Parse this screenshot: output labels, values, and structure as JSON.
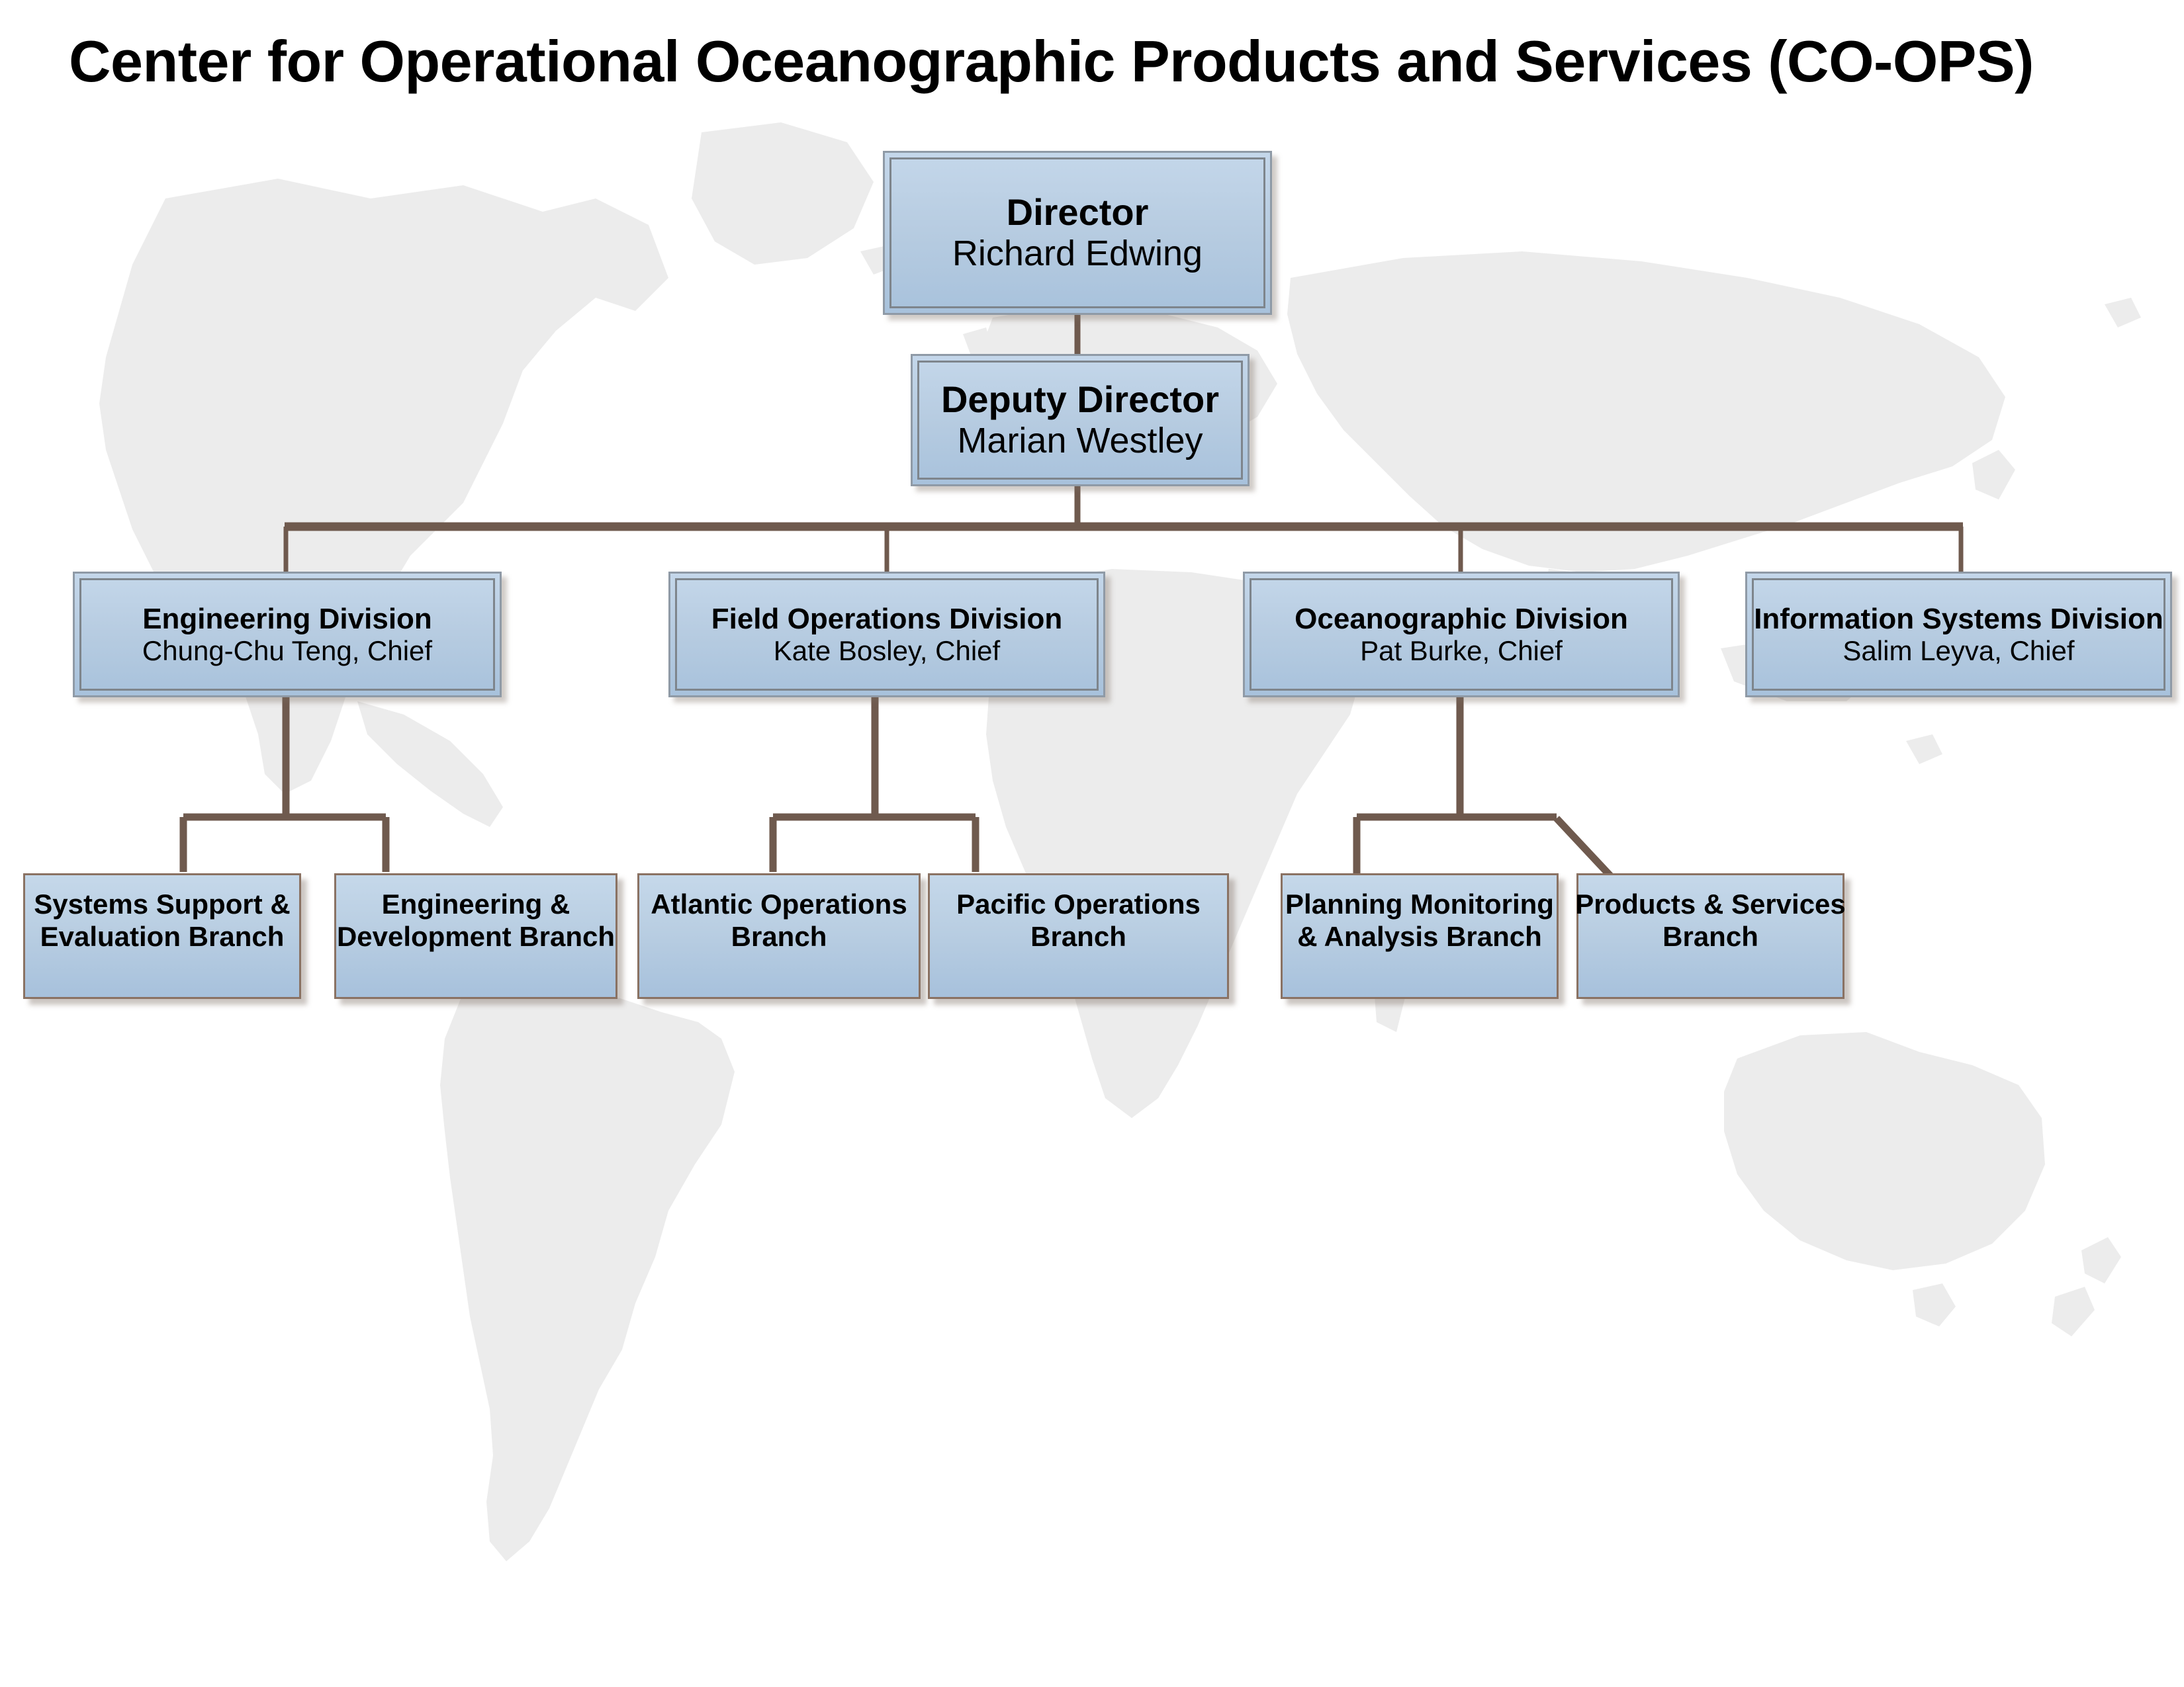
{
  "page": {
    "title": "Center for Operational Oceanographic Products and Services (CO-OPS)",
    "background_map": "world-map-watermark"
  },
  "colors": {
    "box_fill_top": "#c4d7ea",
    "box_fill_bottom": "#a8c2dc",
    "box_border_outer": "#8f9aa6",
    "box_border_inner": "#7e858c",
    "branch_border": "#8a7263",
    "connector_line": "#6f5a4e",
    "map_fill": "#ececec",
    "text": "#000000"
  },
  "org": {
    "director": {
      "role": "Director",
      "name": "Richard Edwing"
    },
    "deputy_director": {
      "role": "Deputy Director",
      "name": "Marian Westley"
    },
    "divisions": [
      {
        "id": "engineering",
        "name": "Engineering Division",
        "chief": "Chung-Chu Teng, Chief",
        "branches": [
          {
            "id": "systems-support",
            "line1": "Systems Support &",
            "line2": "Evaluation Branch"
          },
          {
            "id": "engineering-development",
            "line1": "Engineering &",
            "line2": "Development Branch"
          }
        ]
      },
      {
        "id": "field-operations",
        "name": "Field Operations Division",
        "chief": "Kate Bosley, Chief",
        "branches": [
          {
            "id": "atlantic-operations",
            "line1": "Atlantic Operations",
            "line2": "Branch"
          },
          {
            "id": "pacific-operations",
            "line1": "Pacific Operations",
            "line2": "Branch"
          }
        ]
      },
      {
        "id": "oceanographic",
        "name": "Oceanographic Division",
        "chief": "Pat Burke, Chief",
        "branches": [
          {
            "id": "planning-monitoring",
            "line1": "Planning Monitoring",
            "line2": "& Analysis Branch"
          },
          {
            "id": "products-services",
            "line1": "Products & Services",
            "line2": "Branch"
          }
        ]
      },
      {
        "id": "information-systems",
        "name": "Information Systems Division",
        "chief": "Salim Leyva, Chief",
        "branches": []
      }
    ]
  }
}
